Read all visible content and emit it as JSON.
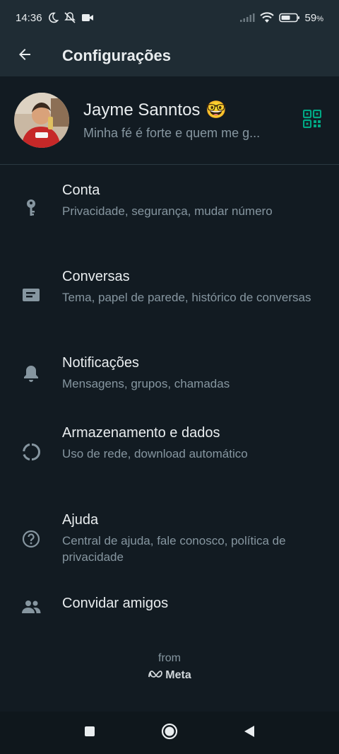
{
  "status_bar": {
    "time": "14:36",
    "battery_percent": "59",
    "battery_unit": "%",
    "icons": [
      "moon-icon",
      "muted-icon",
      "video-icon",
      "signal-icon",
      "wifi-icon",
      "battery-icon"
    ]
  },
  "header": {
    "title": "Configurações",
    "back_icon": "arrow-left-icon"
  },
  "profile": {
    "name": "Jayme Sanntos",
    "emoji": "🤓",
    "status": "Minha fé é forte e quem me g...",
    "qr_icon": "qr-code-icon"
  },
  "menu": [
    {
      "title": "Conta",
      "subtitle": "Privacidade, segurança, mudar número",
      "icon": "key-icon"
    },
    {
      "title": "Conversas",
      "subtitle": "Tema, papel de parede, histórico de conversas",
      "icon": "chat-icon"
    },
    {
      "title": "Notificações",
      "subtitle": "Mensagens, grupos, chamadas",
      "icon": "bell-icon"
    },
    {
      "title": "Armazenamento e dados",
      "subtitle": "Uso de rede, download automático",
      "icon": "data-usage-icon"
    },
    {
      "title": "Ajuda",
      "subtitle": "Central de ajuda, fale conosco, política de privacidade",
      "icon": "help-icon"
    },
    {
      "title": "Convidar amigos",
      "subtitle": "",
      "icon": "people-icon"
    }
  ],
  "footer": {
    "from_label": "from",
    "brand": "Meta"
  },
  "colors": {
    "background": "#121b22",
    "app_bar": "#1f2c34",
    "primary_text": "#e9edef",
    "secondary_text": "#8696a0",
    "accent": "#00a884"
  },
  "nav": {
    "icons": [
      "recents-square-icon",
      "home-circle-icon",
      "back-triangle-icon"
    ]
  }
}
